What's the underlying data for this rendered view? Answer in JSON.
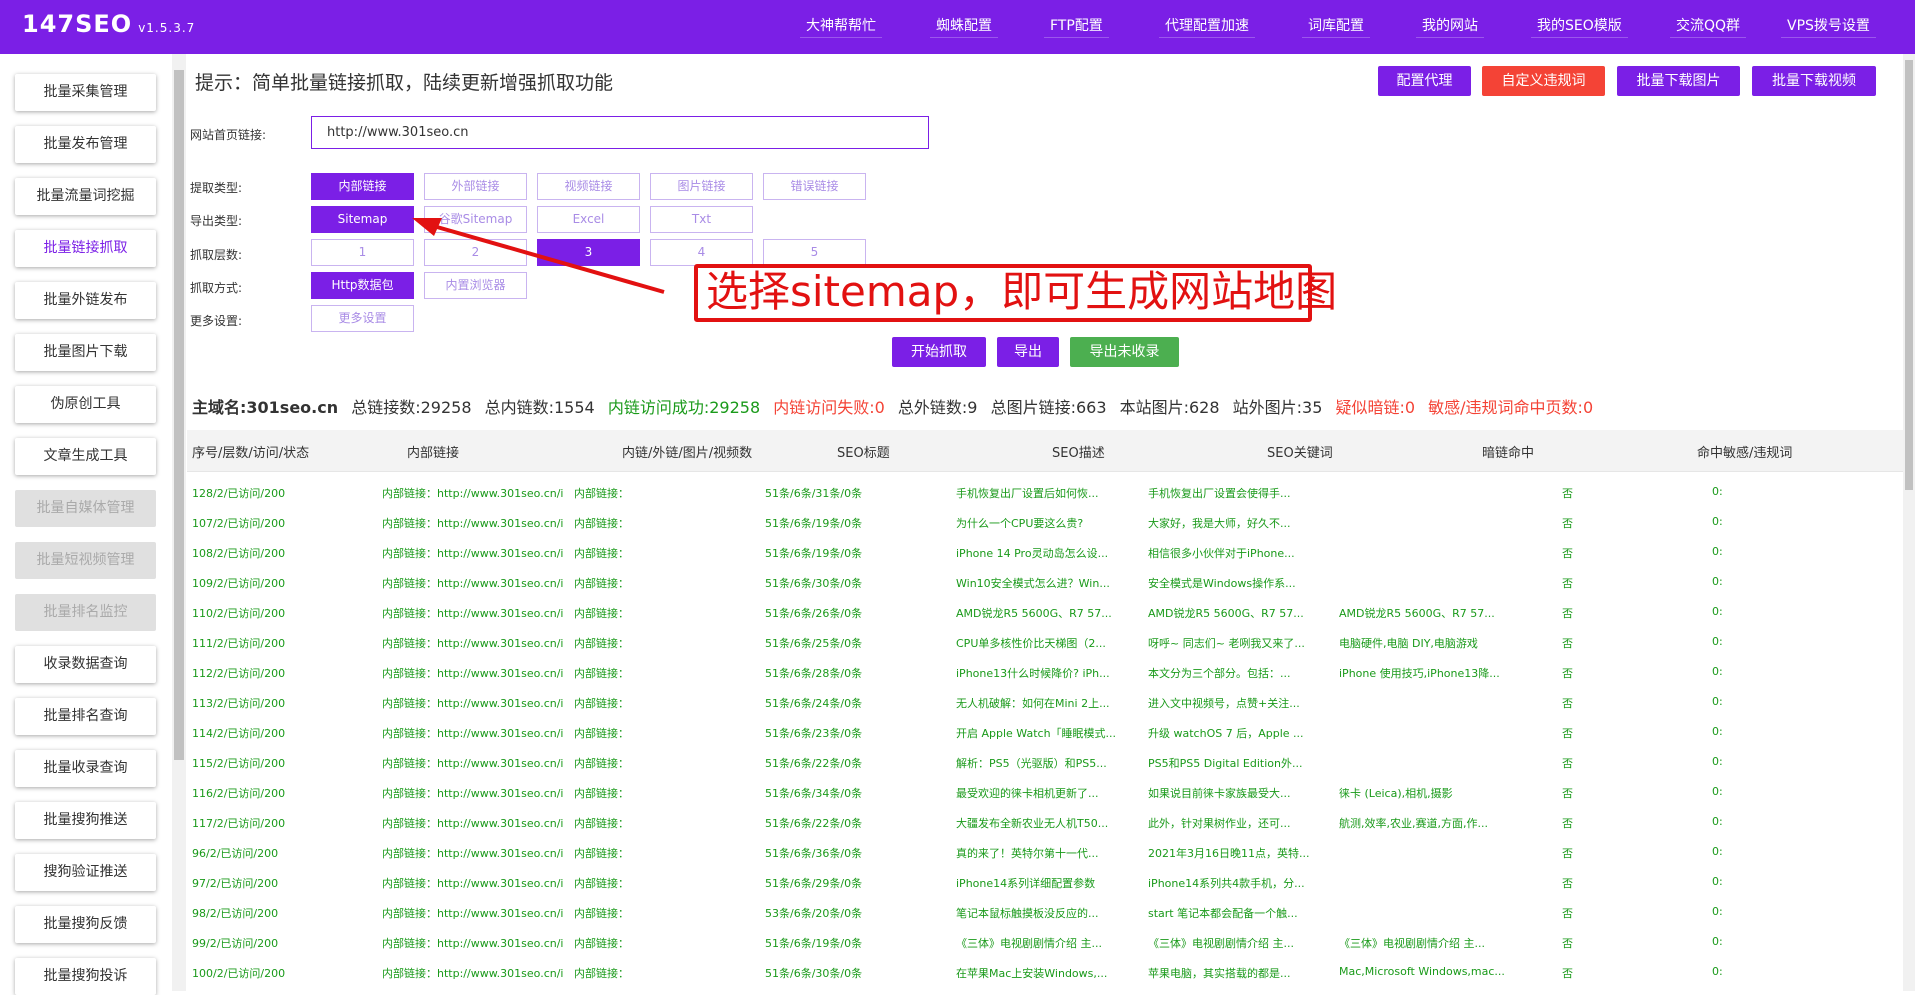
{
  "app": {
    "name": "147SEO",
    "version": "v1.5.3.7"
  },
  "nav": [
    "大神帮帮忙",
    "蜘蛛配置",
    "FTP配置",
    "代理配置加速",
    "词库配置",
    "我的网站",
    "我的SEO模版",
    "交流QQ群",
    "VPS拨号设置"
  ],
  "sidebar": [
    {
      "label": "批量采集管理",
      "state": "normal"
    },
    {
      "label": "批量发布管理",
      "state": "normal"
    },
    {
      "label": "批量流量词挖掘",
      "state": "normal"
    },
    {
      "label": "批量链接抓取",
      "state": "active"
    },
    {
      "label": "批量外链发布",
      "state": "normal"
    },
    {
      "label": "批量图片下载",
      "state": "normal"
    },
    {
      "label": "伪原创工具",
      "state": "normal"
    },
    {
      "label": "文章生成工具",
      "state": "normal"
    },
    {
      "label": "批量自媒体管理",
      "state": "disabled"
    },
    {
      "label": "批量短视频管理",
      "state": "disabled"
    },
    {
      "label": "批量排名监控",
      "state": "disabled"
    },
    {
      "label": "收录数据查询",
      "state": "normal"
    },
    {
      "label": "批量排名查询",
      "state": "normal"
    },
    {
      "label": "批量收录查询",
      "state": "normal"
    },
    {
      "label": "批量搜狗推送",
      "state": "normal"
    },
    {
      "label": "搜狗验证推送",
      "state": "normal"
    },
    {
      "label": "批量搜狗反馈",
      "state": "normal"
    },
    {
      "label": "批量搜狗投诉",
      "state": "normal"
    }
  ],
  "tip": "提示：简单批量链接抓取，陆续更新增强抓取功能",
  "top_buttons": [
    "配置代理",
    "自定义违规词",
    "批量下载图片",
    "批量下载视频"
  ],
  "form": {
    "url_label": "网站首页链接:",
    "url_value": "http://www.301seo.cn",
    "extract_label": "提取类型:",
    "extract_options": [
      "内部链接",
      "外部链接",
      "视频链接",
      "图片链接",
      "错误链接"
    ],
    "export_label": "导出类型:",
    "export_options": [
      "Sitemap",
      "谷歌Sitemap",
      "Excel",
      "Txt"
    ],
    "depth_label": "抓取层数:",
    "depth_options": [
      "1",
      "2",
      "3",
      "4",
      "5"
    ],
    "method_label": "抓取方式:",
    "method_options": [
      "Http数据包",
      "内置浏览器"
    ],
    "more_label": "更多设置:",
    "more_button": "更多设置"
  },
  "actions": [
    "开始抓取",
    "导出",
    "导出未收录"
  ],
  "callout": "选择sitemap，即可生成网站地图",
  "stats": {
    "domain": "主域名:301seo.cn",
    "total_links": "总链接数:29258",
    "internal_links": "总内链数:1554",
    "internal_ok": "内链访问成功:29258",
    "internal_fail": "内链访问失败:0",
    "external_links": "总外链数:9",
    "image_links": "总图片链接:663",
    "site_images": "本站图片:628",
    "external_images": "站外图片:35",
    "dark_links": "疑似暗链:0",
    "sensitive_pages": "敏感/违规词命中页数:0"
  },
  "table": {
    "headers": [
      "序号/层数/访问/状态",
      "内部链接",
      "内链/外链/图片/视频数",
      "SEO标题",
      "SEO描述",
      "SEO关键词",
      "暗链命中",
      "命中敏感/违规词"
    ],
    "rows": [
      [
        "128/2/已访问/200",
        "内部链接：http://www.301seo.cn/i",
        "内部链接：",
        "51条/6条/31条/0条",
        "手机恢复出厂设置后如何恢...",
        "手机恢复出厂设置会使得手...",
        "",
        "否",
        "0:"
      ],
      [
        "107/2/已访问/200",
        "内部链接：http://www.301seo.cn/i",
        "内部链接：",
        "51条/6条/19条/0条",
        "为什么一个CPU要这么贵?",
        "大家好，我是大师，好久不...",
        "",
        "否",
        "0:"
      ],
      [
        "108/2/已访问/200",
        "内部链接：http://www.301seo.cn/i",
        "内部链接：",
        "51条/6条/19条/0条",
        "iPhone 14 Pro灵动岛怎么设...",
        "相信很多小伙伴对于iPhone...",
        "",
        "否",
        "0:"
      ],
      [
        "109/2/已访问/200",
        "内部链接：http://www.301seo.cn/i",
        "内部链接：",
        "51条/6条/30条/0条",
        "Win10安全模式怎么进？Win...",
        "安全模式是Windows操作系...",
        "",
        "否",
        "0:"
      ],
      [
        "110/2/已访问/200",
        "内部链接：http://www.301seo.cn/i",
        "内部链接：",
        "51条/6条/26条/0条",
        "AMD锐龙R5 5600G、R7 57...",
        "AMD锐龙R5 5600G、R7 57...",
        "AMD锐龙R5 5600G、R7 57...",
        "否",
        "0:"
      ],
      [
        "111/2/已访问/200",
        "内部链接：http://www.301seo.cn/i",
        "内部链接：",
        "51条/6条/25条/0条",
        "CPU单多核性价比天梯图（2...",
        "呀呼~ 同志们~ 老咧我又来了...",
        "电脑硬件,电脑 DIY,电脑游戏",
        "否",
        "0:"
      ],
      [
        "112/2/已访问/200",
        "内部链接：http://www.301seo.cn/i",
        "内部链接：",
        "51条/6条/28条/0条",
        "iPhone13什么时候降价? iPh...",
        "本文分为三个部分。包括：...",
        "iPhone 使用技巧,iPhone13降...",
        "否",
        "0:"
      ],
      [
        "113/2/已访问/200",
        "内部链接：http://www.301seo.cn/i",
        "内部链接：",
        "51条/6条/24条/0条",
        "无人机破解：如何在Mini 2上...",
        "进入文中视频号，点赞+关注...",
        "",
        "否",
        "0:"
      ],
      [
        "114/2/已访问/200",
        "内部链接：http://www.301seo.cn/i",
        "内部链接：",
        "51条/6条/23条/0条",
        "开启 Apple Watch「睡眠模式...",
        "升级 watchOS 7 后，Apple ...",
        "",
        "否",
        "0:"
      ],
      [
        "115/2/已访问/200",
        "内部链接：http://www.301seo.cn/i",
        "内部链接：",
        "51条/6条/22条/0条",
        "解析：PS5（光驱版）和PS5...",
        "PS5和PS5 Digital Edition外...",
        "",
        "否",
        "0:"
      ],
      [
        "116/2/已访问/200",
        "内部链接：http://www.301seo.cn/i",
        "内部链接：",
        "51条/6条/34条/0条",
        "最受欢迎的徕卡相机更新了...",
        "如果说目前徕卡家族最受大...",
        "徕卡 (Leica),相机,摄影",
        "否",
        "0:"
      ],
      [
        "117/2/已访问/200",
        "内部链接：http://www.301seo.cn/i",
        "内部链接：",
        "51条/6条/22条/0条",
        "大疆发布全新农业无人机T50...",
        "此外，针对果树作业，还可...",
        "航测,效率,农业,赛道,方面,作...",
        "否",
        "0:"
      ],
      [
        "96/2/已访问/200",
        "内部链接：http://www.301seo.cn/i",
        "内部链接：",
        "51条/6条/36条/0条",
        "真的来了！英特尔第十一代...",
        "2021年3月16日晚11点，英特...",
        "",
        "否",
        "0:"
      ],
      [
        "97/2/已访问/200",
        "内部链接：http://www.301seo.cn/i",
        "内部链接：",
        "51条/6条/29条/0条",
        "iPhone14系列详细配置参数",
        "iPhone14系列共4款手机，分...",
        "",
        "否",
        "0:"
      ],
      [
        "98/2/已访问/200",
        "内部链接：http://www.301seo.cn/i",
        "内部链接：",
        "53条/6条/20条/0条",
        "笔记本鼠标触摸板没反应的...",
        "start 笔记本都会配备一个触...",
        "",
        "否",
        "0:"
      ],
      [
        "99/2/已访问/200",
        "内部链接：http://www.301seo.cn/i",
        "内部链接：",
        "51条/6条/19条/0条",
        "《三体》电视剧剧情介绍 主...",
        "《三体》电视剧剧情介绍 主...",
        "《三体》电视剧剧情介绍 主...",
        "否",
        "0:"
      ],
      [
        "100/2/已访问/200",
        "内部链接：http://www.301seo.cn/i",
        "内部链接：",
        "51条/6条/30条/0条",
        "在苹果Mac上安装Windows,...",
        "苹果电脑，其实搭载的都是...",
        "Mac,Microsoft Windows,mac...",
        "否",
        "0:"
      ]
    ]
  }
}
